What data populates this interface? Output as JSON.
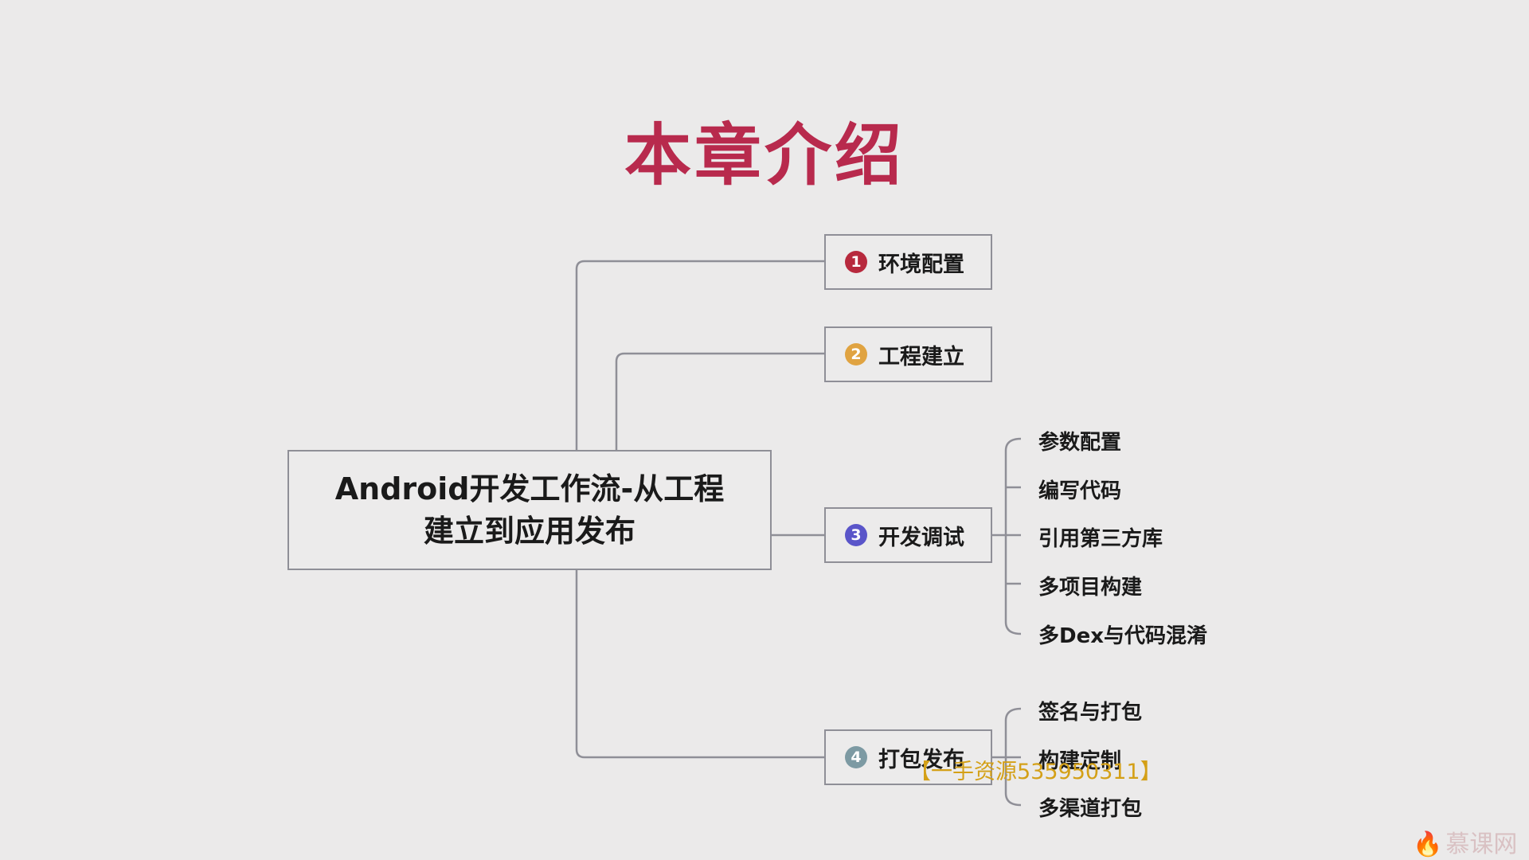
{
  "title": "本章介绍",
  "center": {
    "line1": "Android开发工作流-从工程",
    "line2": "建立到应用发布"
  },
  "branches": [
    {
      "num": "1",
      "label": "环境配置",
      "color": "#b7293d"
    },
    {
      "num": "2",
      "label": "工程建立",
      "color": "#e0a341"
    },
    {
      "num": "3",
      "label": "开发调试",
      "color": "#5a55c9",
      "children": [
        "参数配置",
        "编写代码",
        "引用第三方库",
        "多项目构建",
        "多Dex与代码混淆"
      ]
    },
    {
      "num": "4",
      "label": "打包发布",
      "color": "#7d9aa3",
      "children": [
        "签名与打包",
        "构建定制",
        "多渠道打包"
      ]
    }
  ],
  "watermark": "【一手资源535950311】",
  "logo": "慕课网",
  "colors": {
    "title": "#b82a4d",
    "background": "#ebeaea",
    "line": "#8f8f97"
  }
}
